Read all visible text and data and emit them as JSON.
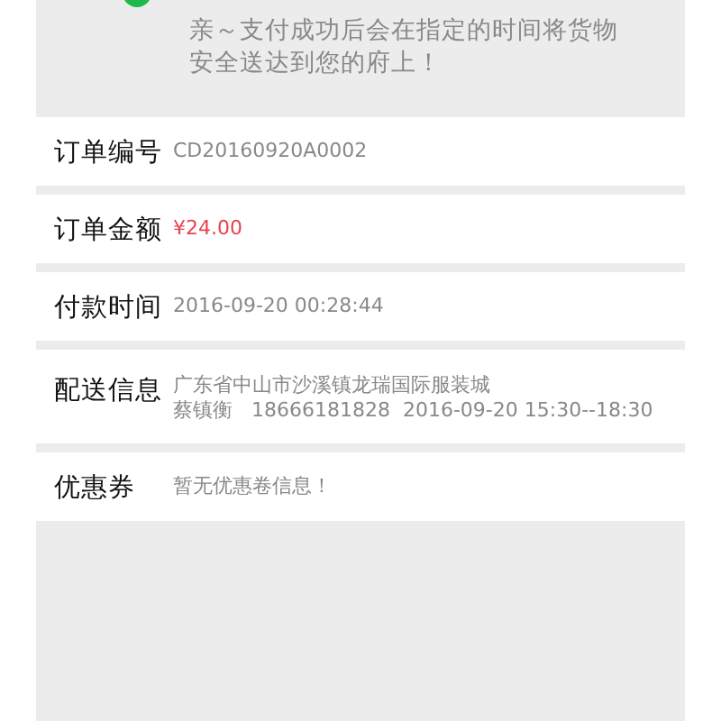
{
  "notice": {
    "lines": [
      "亲～支付成功后会在指定的时间将货物",
      "安全送达到您的府上！"
    ]
  },
  "rows": [
    {
      "label": "订单编号",
      "kind": "plain",
      "lines": [
        "CD20160920A0002"
      ]
    },
    {
      "label": "订单金额",
      "kind": "price",
      "lines": [
        "¥24.00"
      ]
    },
    {
      "label": "付款时间",
      "kind": "plain",
      "lines": [
        "2016-09-20 00:28:44"
      ]
    },
    {
      "label": "配送信息",
      "kind": "plain",
      "lines": [
        "广东省中山市沙溪镇龙瑞国际服装城",
        "蔡镇衡   18666181828  2016-09-20 15:30--18:30"
      ]
    },
    {
      "label": "优惠券",
      "kind": "plain",
      "lines": [
        "暂无优惠卷信息！"
      ]
    }
  ]
}
